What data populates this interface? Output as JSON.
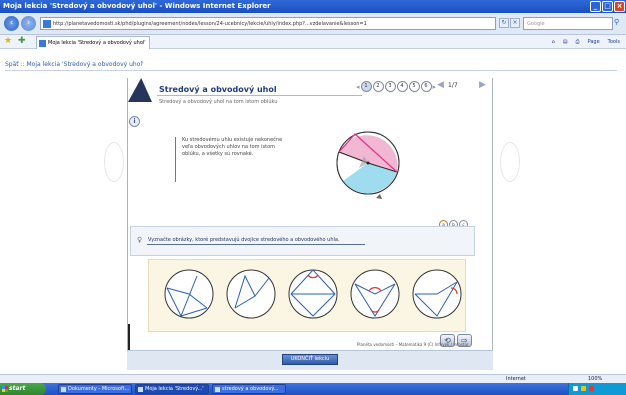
{
  "window": {
    "title": "Moja lekcia 'Stredový a obvodový uhol' - Windows Internet Explorer",
    "buttons": [
      "_",
      "□",
      "×"
    ]
  },
  "browser": {
    "back_icon": "back-arrow-icon",
    "forward_icon": "forward-arrow-icon",
    "address": "http://planetavedomosti.sk/phd/plugins/agreement/nodes/lesson/24-ucebnicy/lekcie/uhly/index.php?...vzdelavanie&lesson=1",
    "search_placeholder": "Google",
    "tab_label": "Moja lekcia 'Stredový a obvodový uhol'",
    "toolbar": {
      "home": "⌂",
      "feeds": "▤",
      "print": "⎙",
      "page": "Page",
      "tools": "Tools"
    }
  },
  "page": {
    "back_link": "Späť :: Moja lekcia 'Stredový a obvodový uhol'",
    "lesson": {
      "title": "Stredový a obvodový uhol",
      "subtitle": "Stredový a obvodový uhol na tom istom oblúku",
      "nav_dots": [
        "1",
        "2",
        "3",
        "4",
        "5",
        "6"
      ],
      "page_counter": "1/7",
      "info_icon": "i",
      "explanation": "Ku stredovému uhlu existuje nekonečne veľa obvodových uhlov na tom istom oblúku, a všetky sú rovnaké.",
      "small_nav": [
        "a",
        "b",
        "c"
      ],
      "task": "Vyznačte obrázky, ktoré predstavujú dvojice stredového a obvodového uhla.",
      "footer": "Planéta vedomostí – Matematika 9 (C) Infovek / Infostar",
      "close_button": "UKONČIŤ lekciu"
    }
  },
  "statusbar": {
    "zone": "Internet",
    "zoom": "100%"
  },
  "taskbar": {
    "start": "start",
    "items": [
      "Dokumenty - Microsoft...",
      "Moja lekcia 'Stredový...'",
      "stredový a obvodový..."
    ]
  },
  "colors": {
    "accent": "#2f5db4",
    "titlebar": "#1a4fc0",
    "circle_highlight": "#e85aa0",
    "circle_blue": "#60c8e8"
  }
}
